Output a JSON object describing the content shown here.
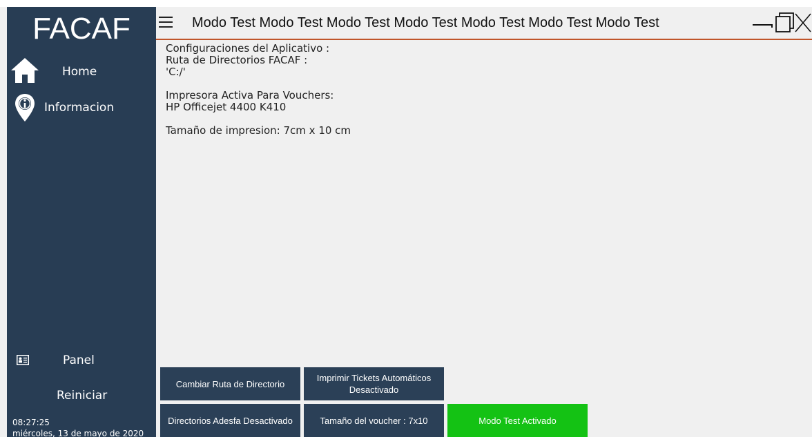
{
  "app": {
    "brand": "FACAF"
  },
  "header": {
    "title": "Modo Test Modo Test Modo Test Modo Test  Modo Test  Modo Test  Modo Test"
  },
  "sidebar": {
    "items": [
      {
        "label": "Home",
        "icon": "home-icon"
      },
      {
        "label": "Informacion",
        "icon": "info-pin-icon"
      },
      {
        "label": "Panel",
        "icon": "id-card-icon"
      },
      {
        "label": "Reiniciar"
      }
    ],
    "clock": {
      "time": "08:27:25",
      "date": "miércoles, 13 de mayo de 2020"
    }
  },
  "content": {
    "lines": [
      "Configuraciones del Aplicativo :",
      "Ruta de Directorios FACAF :",
      "'C:/'",
      "",
      "Impresora Activa Para Vouchers:",
      "HP Officejet 4400 K410",
      "",
      "Tamaño de impresion: 7cm x 10 cm"
    ]
  },
  "buttons": {
    "change_dir": "Cambiar Ruta de Directorio",
    "print_tickets": "Imprimir Tickets Automáticos Desactivado",
    "adesfa": "Directorios Adesfa Desactivado",
    "voucher_size": "Tamaño del voucher : 7x10",
    "test_mode": "Modo Test Activado"
  },
  "colors": {
    "sidebar": "#283d54",
    "button": "#2b4057",
    "accent_line": "#c0552a",
    "active_green": "#14c214"
  }
}
